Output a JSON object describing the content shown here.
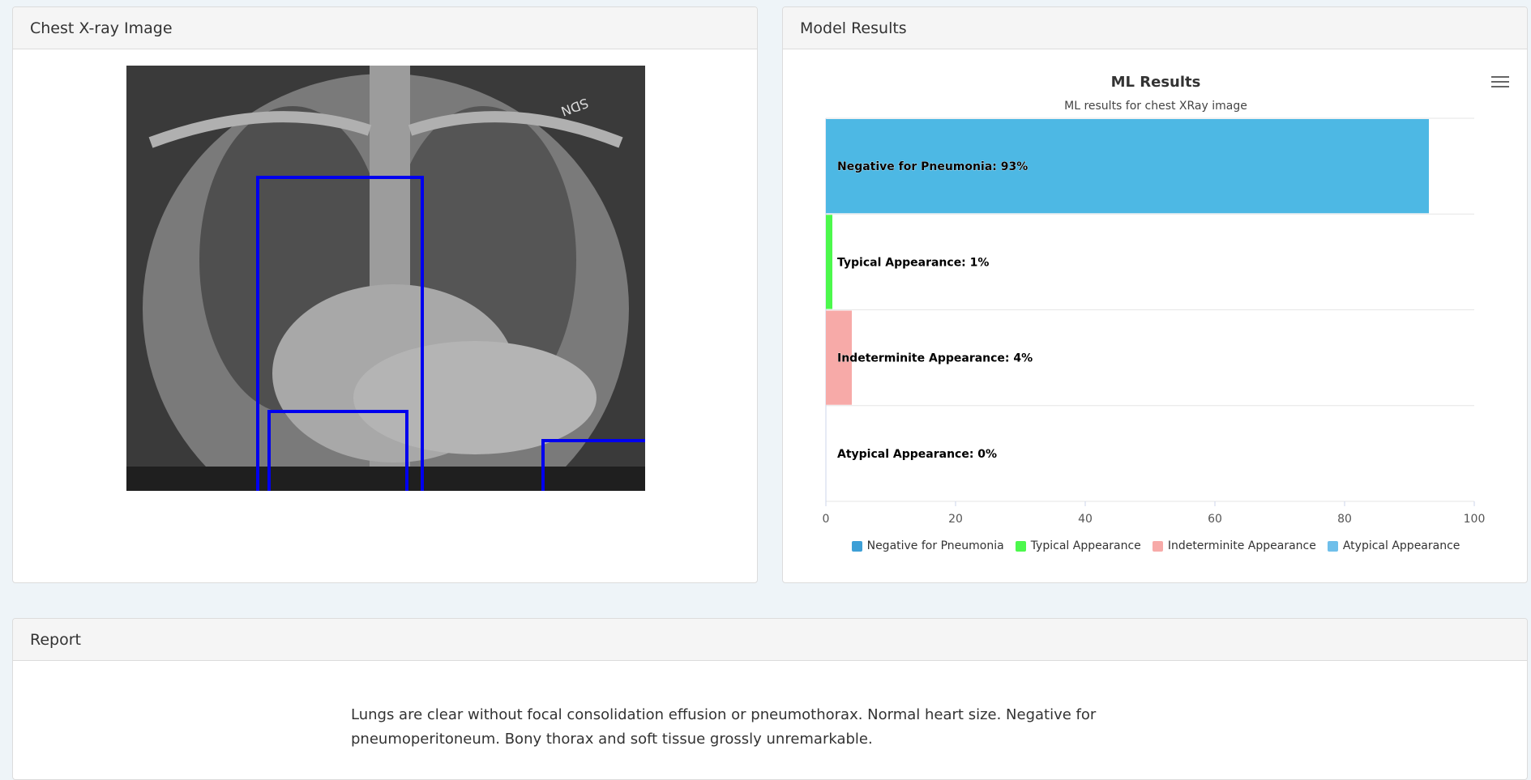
{
  "xray_panel": {
    "title": "Chest X-ray Image"
  },
  "model_panel": {
    "title": "Model Results"
  },
  "report_panel": {
    "title": "Report",
    "text": "Lungs are clear without focal consolidation effusion or pneumothorax. Normal heart size. Negative for pneumoperitoneum. Bony thorax and soft tissue grossly unremarkable."
  },
  "icons": {
    "chart_menu": "hamburger-menu-icon"
  },
  "colors": {
    "bounding_box": "#0000ee",
    "negative": "#4db8e4",
    "typical": "#4cf84c",
    "indeterminate": "#f7aaa8",
    "atypical": "#6fbfea",
    "legend_negative": "#3d9fd6"
  },
  "chart_data": {
    "type": "bar",
    "orientation": "horizontal",
    "title": "ML Results",
    "subtitle": "ML results for chest XRay image",
    "categories": [
      "Negative for Pneumonia",
      "Typical Appearance",
      "Indeterminite Appearance",
      "Atypical Appearance"
    ],
    "values": [
      93,
      1,
      4,
      0
    ],
    "data_labels": [
      "Negative for Pneumonia: 93%",
      "Typical Appearance: 1%",
      "Indeterminite Appearance: 4%",
      "Atypical Appearance: 0%"
    ],
    "xlim": [
      0,
      100
    ],
    "ticks": [
      "0",
      "20",
      "40",
      "60",
      "80",
      "100"
    ],
    "legend": [
      "Negative for Pneumonia",
      "Typical Appearance",
      "Indeterminite Appearance",
      "Atypical Appearance"
    ],
    "legend_position": "bottom",
    "grid": true
  }
}
